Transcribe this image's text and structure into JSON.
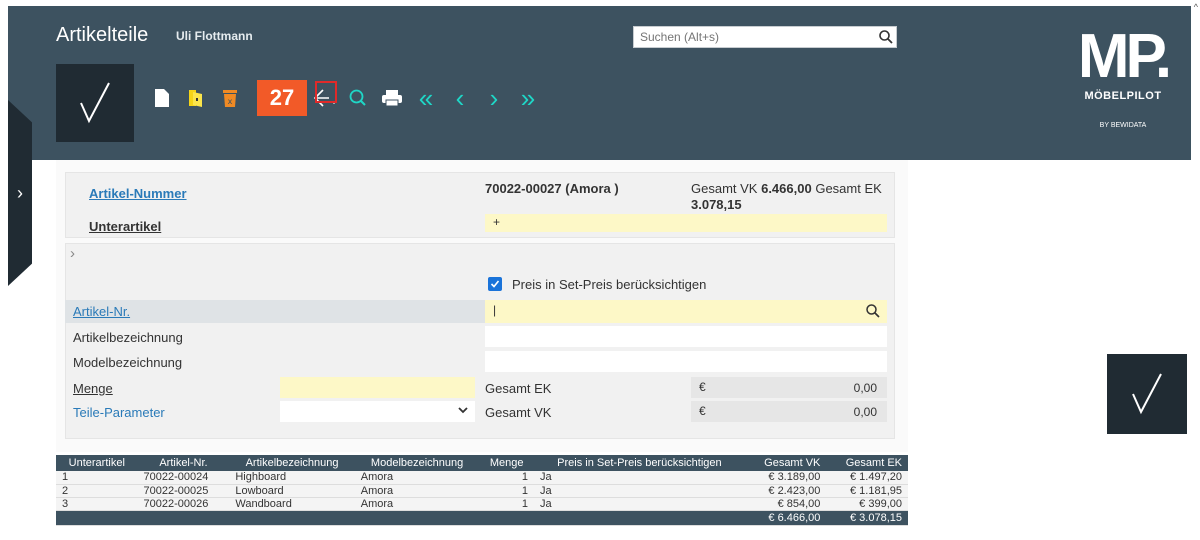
{
  "header": {
    "title": "Artikelteile",
    "user": "Uli Flottmann",
    "search_placeholder": "Suchen (Alt+s)",
    "step_badge": "27",
    "logo_mp": "MP.",
    "logo_name": "MÖBELPILOT",
    "logo_by": "BY BEWIDATA"
  },
  "form": {
    "artikel_nummer_label": "Artikel-Nummer",
    "artikel_nummer_value": "70022-00027 (Amora )",
    "gesamt_vk_label": "Gesamt VK",
    "gesamt_vk_value": "6.466,00",
    "gesamt_ek_label": "Gesamt EK",
    "gesamt_ek_value": "3.078,15",
    "unterartikel_label": "Unterartikel",
    "unterartikel_value": "+",
    "preis_checkbox_label": "Preis in Set-Preis berücksichtigen",
    "artikel_nr_label": "Artikel-Nr.",
    "artikel_nr_value": "|",
    "artikelbezeichnung_label": "Artikelbezeichnung",
    "modelbezeichnung_label": "Modelbezeichnung",
    "menge_label": "Menge",
    "teile_parameter_label": "Teile-Parameter",
    "gesamt_ek_field_label": "Gesamt EK",
    "gesamt_vk_field_label": "Gesamt VK",
    "currency": "€",
    "gesamt_ek_field_value": "0,00",
    "gesamt_vk_field_value": "0,00"
  },
  "table": {
    "headers": [
      "Unterartikel",
      "Artikel-Nr.",
      "Artikelbezeichnung",
      "Modelbezeichnung",
      "Menge",
      "Preis in Set-Preis berücksichtigen",
      "Gesamt VK",
      "Gesamt EK"
    ],
    "rows": [
      [
        "1",
        "70022-00024",
        "Highboard",
        "Amora",
        "1",
        "Ja",
        "€ 3.189,00",
        "€ 1.497,20"
      ],
      [
        "2",
        "70022-00025",
        "Lowboard",
        "Amora",
        "1",
        "Ja",
        "€ 2.423,00",
        "€ 1.181,95"
      ],
      [
        "3",
        "70022-00026",
        "Wandboard",
        "Amora",
        "1",
        "Ja",
        "€ 854,00",
        "€ 399,00"
      ]
    ],
    "total_vk": "€ 6.466,00",
    "total_ek": "€ 3.078,15"
  },
  "icons": {
    "check": "✓",
    "chevron_right": "›",
    "search": "search-icon"
  }
}
